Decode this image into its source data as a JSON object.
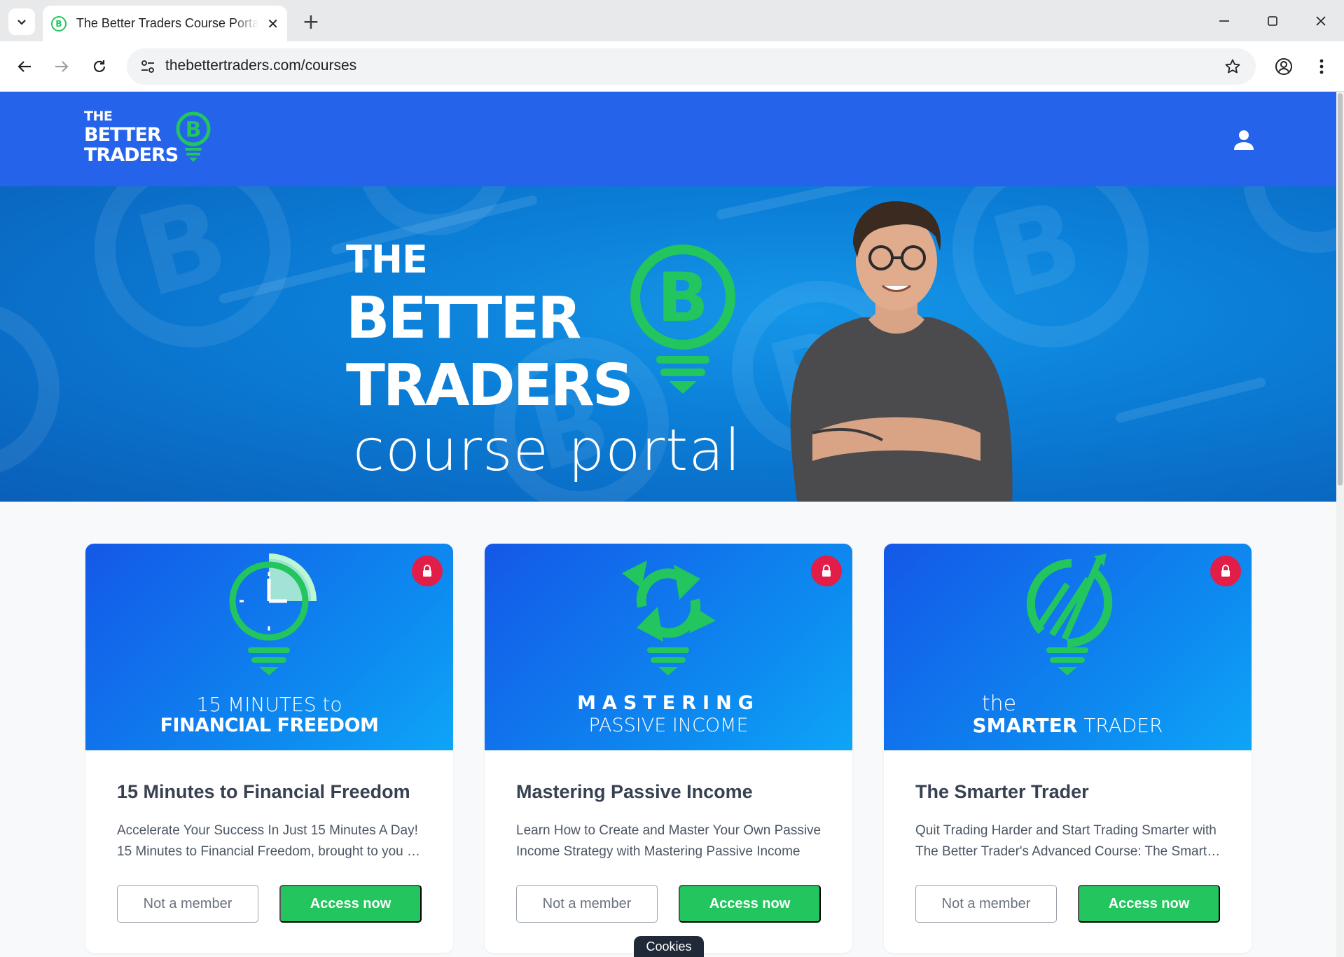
{
  "browser": {
    "tab_title": "The Better Traders Course Portal",
    "url": "thebettertraders.com/courses",
    "new_tab_glyph": "+",
    "close_glyph": "✕"
  },
  "header": {
    "logo": {
      "line1": "THE",
      "line2": "BETTER",
      "line3": "TRADERS"
    },
    "icons": [
      "user-icon"
    ]
  },
  "hero": {
    "line1": "THE",
    "line2": "BETTER",
    "line3": "TRADERS",
    "subtitle": "course portal"
  },
  "courses": [
    {
      "image_line1": "15  MINUTES to",
      "image_line2": "FINANCIAL FREEDOM",
      "title": "15 Minutes to Financial Freedom",
      "description": "Accelerate Your Success In Just 15 Minutes A Day! 15 Minutes to Financial Freedom, brought to you by The Better Traders",
      "secondary_label": "Not a member",
      "primary_label": "Access now"
    },
    {
      "image_line1": "MASTERING",
      "image_line2": "PASSIVE INCOME",
      "title": "Mastering Passive Income",
      "description": "Learn How to Create and Master Your Own Passive Income Strategy with Mastering Passive Income",
      "secondary_label": "Not a member",
      "primary_label": "Access now"
    },
    {
      "image_line1": "the",
      "image_line2a": "SMARTER",
      "image_line2b": " TRADER",
      "title": "The Smarter Trader",
      "description": "Quit Trading Harder and Start Trading Smarter with The Better Trader's Advanced Course: The Smarter Trader",
      "secondary_label": "Not a member",
      "primary_label": "Access now"
    }
  ],
  "cookies_label": "Cookies",
  "colors": {
    "brand_blue": "#2563eb",
    "accent_green": "#22c55e",
    "lock_red": "#e11d48"
  }
}
